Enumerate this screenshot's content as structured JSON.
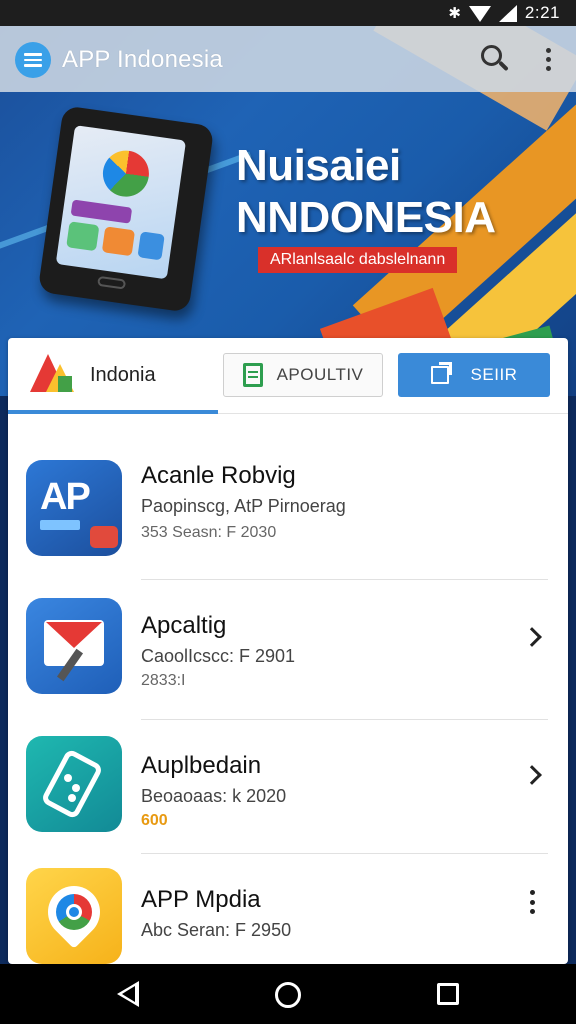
{
  "status_bar": {
    "time": "2:21",
    "icons": [
      "vibrate-icon",
      "wifi-icon",
      "signal-icon"
    ]
  },
  "app_bar": {
    "title": "APP Indonesia",
    "icons": [
      "menu-icon",
      "search-icon",
      "overflow-menu-icon"
    ]
  },
  "hero": {
    "headline_line1": "Nuisaiei",
    "headline_line2": "NNDONESIA",
    "tagline": "ARlanlsaalc dabslelnann"
  },
  "tabs": {
    "active_label": "Indonia",
    "button_left_label": "APOULTIV",
    "button_right_label": "SEIIR"
  },
  "apps": [
    {
      "title": "Acanle Robvig",
      "subtitle": "Paopinscg, AtP Pirnoerag",
      "meta": "353 Seasn: F 2030",
      "trailing": "none",
      "icon": "ap-app-icon"
    },
    {
      "title": "Apcaltig",
      "subtitle": "CaoolIcscc: F 2901",
      "meta": "2833:I",
      "trailing": "chevron",
      "icon": "mail-app-icon"
    },
    {
      "title": "Auplbedain",
      "subtitle": "Beoaoaas: k 2020",
      "meta": "600",
      "meta_color": "#e89a12",
      "trailing": "chevron",
      "icon": "card-app-icon"
    },
    {
      "title": "APP Mpdia",
      "subtitle": "Abc Seran: F 2950",
      "meta": "",
      "trailing": "kebab",
      "icon": "chrome-app-icon"
    }
  ],
  "nav_bar": {
    "icons": [
      "back-icon",
      "home-icon",
      "recents-icon"
    ]
  },
  "colors": {
    "accent": "#3a8ad8",
    "menu_button": "#3aa0e8",
    "tagline_bg": "#d9302a",
    "app_bar_bg": "#cdd7e2"
  }
}
